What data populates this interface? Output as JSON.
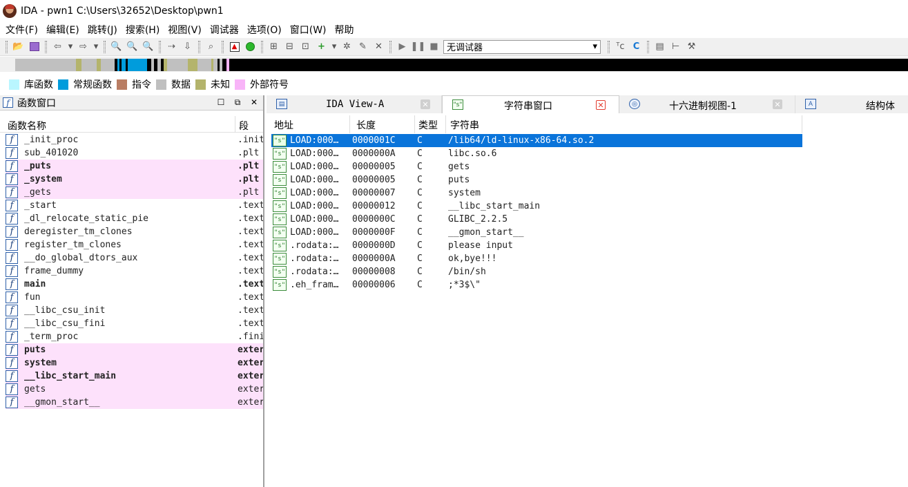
{
  "window": {
    "title": "IDA - pwn1 C:\\Users\\32652\\Desktop\\pwn1"
  },
  "menu": [
    "文件(F)",
    "编辑(E)",
    "跳转(J)",
    "搜索(H)",
    "视图(V)",
    "调试器",
    "选项(O)",
    "窗口(W)",
    "帮助"
  ],
  "toolbar": {
    "debugger_select": "无调试器",
    "debugger_arrow": "▾"
  },
  "colors": {
    "library": "#b9f6ff",
    "regular": "#009cdc",
    "instruction": "#b97d63",
    "data": "#c0c0c0",
    "unexplored": "#b4b46c",
    "external": "#f8b4f8",
    "selection": "#0a74da"
  },
  "legend": [
    {
      "label": "库函数",
      "color": "#b9f6ff"
    },
    {
      "label": "常规函数",
      "color": "#009cdc"
    },
    {
      "label": "指令",
      "color": "#b97d63"
    },
    {
      "label": "数据",
      "color": "#c0c0c0"
    },
    {
      "label": "未知",
      "color": "#b4b46c"
    },
    {
      "label": "外部符号",
      "color": "#f8b4f8"
    }
  ],
  "functions_window": {
    "title": "函数窗口",
    "col_name": "函数名称",
    "col_segment": "段",
    "rows": [
      {
        "name": "_init_proc",
        "segment": ".init",
        "external": false,
        "bold": false
      },
      {
        "name": "sub_401020",
        "segment": ".plt",
        "external": false,
        "bold": false
      },
      {
        "name": "_puts",
        "segment": ".plt",
        "external": true,
        "bold": true
      },
      {
        "name": "_system",
        "segment": ".plt",
        "external": true,
        "bold": true
      },
      {
        "name": "_gets",
        "segment": ".plt",
        "external": true,
        "bold": false
      },
      {
        "name": "_start",
        "segment": ".text",
        "external": false,
        "bold": false
      },
      {
        "name": "_dl_relocate_static_pie",
        "segment": ".text",
        "external": false,
        "bold": false
      },
      {
        "name": "deregister_tm_clones",
        "segment": ".text",
        "external": false,
        "bold": false
      },
      {
        "name": "register_tm_clones",
        "segment": ".text",
        "external": false,
        "bold": false
      },
      {
        "name": "__do_global_dtors_aux",
        "segment": ".text",
        "external": false,
        "bold": false
      },
      {
        "name": "frame_dummy",
        "segment": ".text",
        "external": false,
        "bold": false
      },
      {
        "name": "main",
        "segment": ".text",
        "external": false,
        "bold": true
      },
      {
        "name": "fun",
        "segment": ".text",
        "external": false,
        "bold": false
      },
      {
        "name": "__libc_csu_init",
        "segment": ".text",
        "external": false,
        "bold": false
      },
      {
        "name": "__libc_csu_fini",
        "segment": ".text",
        "external": false,
        "bold": false
      },
      {
        "name": "_term_proc",
        "segment": ".fini",
        "external": false,
        "bold": false
      },
      {
        "name": "puts",
        "segment": "extern",
        "external": true,
        "bold": true
      },
      {
        "name": "system",
        "segment": "extern",
        "external": true,
        "bold": true
      },
      {
        "name": "__libc_start_main",
        "segment": "extern",
        "external": true,
        "bold": true
      },
      {
        "name": "gets",
        "segment": "extern",
        "external": true,
        "bold": false
      },
      {
        "name": "__gmon_start__",
        "segment": "extern",
        "external": true,
        "bold": false
      }
    ]
  },
  "tabs": [
    {
      "label": "IDA View-A",
      "active": false,
      "icon": "ida-view-icon"
    },
    {
      "label": "字符串窗口",
      "active": true,
      "icon": "strings-icon"
    },
    {
      "label": "十六进制视图-1",
      "active": false,
      "icon": "hex-view-icon"
    },
    {
      "label": "结构体",
      "active": false,
      "icon": "structures-icon"
    }
  ],
  "strings_window": {
    "headers": {
      "address": "地址",
      "length": "长度",
      "type": "类型",
      "string": "字符串"
    },
    "rows": [
      {
        "address": "LOAD:000…",
        "length": "0000001C",
        "type": "C",
        "string": "/lib64/ld-linux-x86-64.so.2",
        "selected": true
      },
      {
        "address": "LOAD:000…",
        "length": "0000000A",
        "type": "C",
        "string": "libc.so.6",
        "selected": false
      },
      {
        "address": "LOAD:000…",
        "length": "00000005",
        "type": "C",
        "string": "gets",
        "selected": false
      },
      {
        "address": "LOAD:000…",
        "length": "00000005",
        "type": "C",
        "string": "puts",
        "selected": false
      },
      {
        "address": "LOAD:000…",
        "length": "00000007",
        "type": "C",
        "string": "system",
        "selected": false
      },
      {
        "address": "LOAD:000…",
        "length": "00000012",
        "type": "C",
        "string": "__libc_start_main",
        "selected": false
      },
      {
        "address": "LOAD:000…",
        "length": "0000000C",
        "type": "C",
        "string": "GLIBC_2.2.5",
        "selected": false
      },
      {
        "address": "LOAD:000…",
        "length": "0000000F",
        "type": "C",
        "string": "__gmon_start__",
        "selected": false
      },
      {
        "address": ".rodata:…",
        "length": "0000000D",
        "type": "C",
        "string": "please input",
        "selected": false
      },
      {
        "address": ".rodata:…",
        "length": "0000000A",
        "type": "C",
        "string": "ok,bye!!!",
        "selected": false
      },
      {
        "address": ".rodata:…",
        "length": "00000008",
        "type": "C",
        "string": "/bin/sh",
        "selected": false
      },
      {
        "address": ".eh_fram…",
        "length": "00000006",
        "type": "C",
        "string": ";*3$\\\"",
        "selected": false
      }
    ]
  }
}
